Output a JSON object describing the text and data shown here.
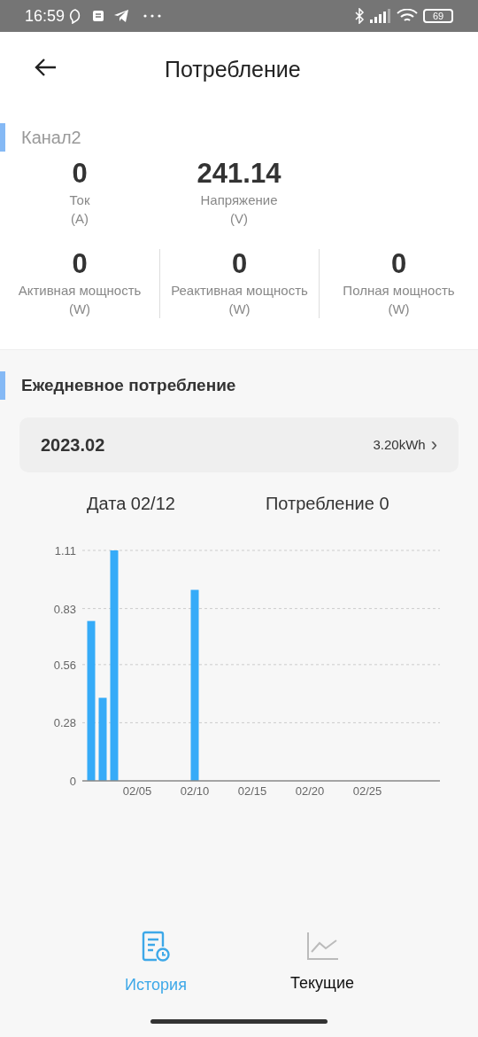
{
  "status_bar": {
    "time": "16:59",
    "battery": "69"
  },
  "header": {
    "title": "Потребление"
  },
  "channel": {
    "title": "Канал2",
    "top_metrics": [
      {
        "value": "0",
        "label": "Ток",
        "unit": "(A)"
      },
      {
        "value": "241.14",
        "label": "Напряжение",
        "unit": "(V)"
      }
    ],
    "power_metrics": [
      {
        "value": "0",
        "label": "Активная мощность",
        "unit": "(W)"
      },
      {
        "value": "0",
        "label": "Реактивная мощность",
        "unit": "(W)"
      },
      {
        "value": "0",
        "label": "Полная мощность",
        "unit": "(W)"
      }
    ]
  },
  "daily": {
    "title": "Ежедневное потребление",
    "month": {
      "label": "2023.02",
      "total": "3.20kWh",
      "chevron": "›"
    },
    "selected_date": "Дата 02/12",
    "selected_consumption": "Потребление 0",
    "chart_data": {
      "type": "bar",
      "categories": [
        null,
        null,
        null,
        null,
        "02/05",
        null,
        null,
        null,
        null,
        "02/10",
        null,
        null,
        null,
        null,
        "02/15",
        null,
        null,
        null,
        null,
        "02/20",
        null,
        null,
        null,
        null,
        "02/25",
        null,
        null,
        null
      ],
      "values": [
        0.77,
        0.4,
        1.11,
        0,
        0,
        0,
        0,
        0,
        0,
        0.92,
        0,
        0,
        0,
        0,
        0,
        0,
        0,
        0,
        0,
        0,
        0,
        0,
        0,
        0,
        0,
        0,
        0,
        0
      ],
      "ylim": [
        0,
        1.11
      ],
      "yticks": [
        0,
        0.28,
        0.56,
        0.83,
        1.11
      ],
      "grid": true
    }
  },
  "bottom_tabs": [
    {
      "label": "История",
      "kind": "history",
      "selected": true
    },
    {
      "label": "Текущие",
      "kind": "current",
      "selected": false
    }
  ]
}
